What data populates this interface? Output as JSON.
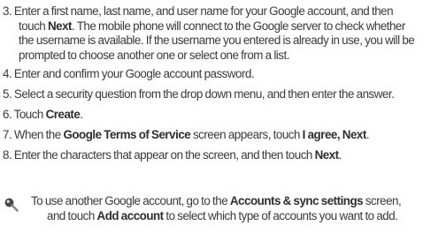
{
  "steps": [
    {
      "lines": [
        {
          "parts": [
            {
              "t": "3. Enter a first name, last name, and user name for your Google account, and then",
              "b": false
            }
          ]
        },
        {
          "parts": [
            {
              "t": "touch ",
              "b": false
            },
            {
              "t": "Next",
              "b": true
            },
            {
              "t": ". The mobile phone will connect to the Google server to check whether",
              "b": false
            }
          ]
        },
        {
          "parts": [
            {
              "t": "the username is available. If the username you entered is already in use, you will be",
              "b": false
            }
          ]
        },
        {
          "parts": [
            {
              "t": "prompted to choose another one or select one from a list.",
              "b": false
            }
          ]
        }
      ]
    },
    {
      "lines": [
        {
          "parts": [
            {
              "t": "4. Enter and confirm your Google account password.",
              "b": false
            }
          ]
        }
      ]
    },
    {
      "lines": [
        {
          "parts": [
            {
              "t": "5. Select a security question from the drop down menu, and then enter the answer.",
              "b": false
            }
          ]
        }
      ]
    },
    {
      "lines": [
        {
          "parts": [
            {
              "t": "6. Touch ",
              "b": false
            },
            {
              "t": "Create",
              "b": true
            },
            {
              "t": ".",
              "b": false
            }
          ]
        }
      ]
    },
    {
      "lines": [
        {
          "parts": [
            {
              "t": "7. When the ",
              "b": false
            },
            {
              "t": "Google Terms of Service",
              "b": true
            },
            {
              "t": " screen appears, touch ",
              "b": false
            },
            {
              "t": "I agree, Next",
              "b": true
            },
            {
              "t": ".",
              "b": false
            }
          ]
        }
      ]
    },
    {
      "lines": [
        {
          "parts": [
            {
              "t": "8. Enter the characters that appear on the screen, and then touch ",
              "b": false
            },
            {
              "t": "Next",
              "b": true
            },
            {
              "t": ".",
              "b": false
            }
          ]
        }
      ]
    }
  ],
  "note": {
    "icon": "tip-magnifier-icon",
    "lines": [
      {
        "parts": [
          {
            "t": "To use another Google account, go to the ",
            "b": false
          },
          {
            "t": "Accounts & sync settings",
            "b": true
          },
          {
            "t": " screen,",
            "b": false
          }
        ]
      },
      {
        "parts": [
          {
            "t": "and touch ",
            "b": false
          },
          {
            "t": "Add account",
            "b": true
          },
          {
            "t": " to select which type of accounts you want to add.",
            "b": false
          }
        ]
      }
    ]
  }
}
